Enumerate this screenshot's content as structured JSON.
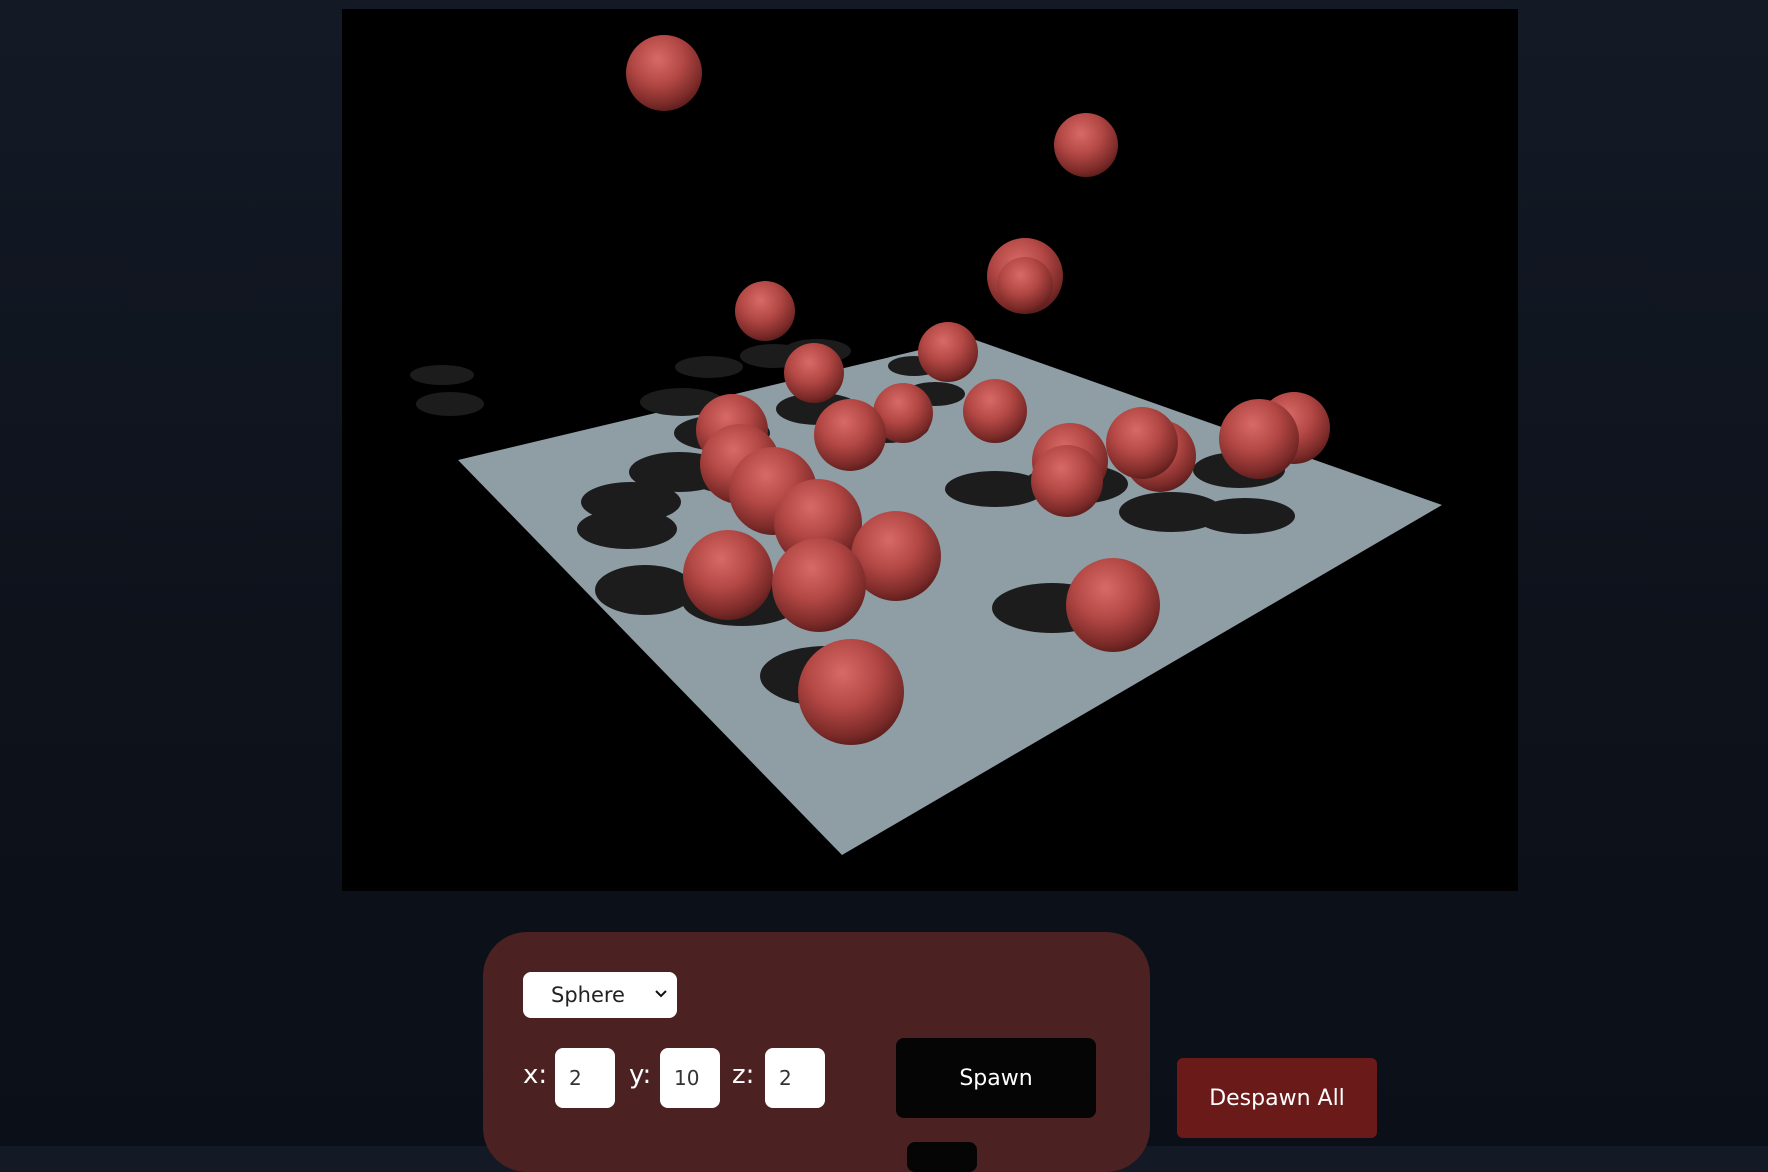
{
  "scene": {
    "ground_color": "#8f9ea5",
    "sphere_color": "#b34a47",
    "shadow_color": "#1c1c1c",
    "background_color": "#000000"
  },
  "controls": {
    "shape_select": {
      "selected": "Sphere",
      "icon": "chevron-down-icon"
    },
    "x_label": "x:",
    "x_value": "2",
    "y_label": "y:",
    "y_value": "10",
    "z_label": "z:",
    "z_value": "2",
    "spawn_label": "Spawn",
    "despawn_label": "Despawn All"
  },
  "colors": {
    "panel": "#4b2122",
    "spawn_button": "#050505",
    "despawn_button": "#6a1a19"
  }
}
